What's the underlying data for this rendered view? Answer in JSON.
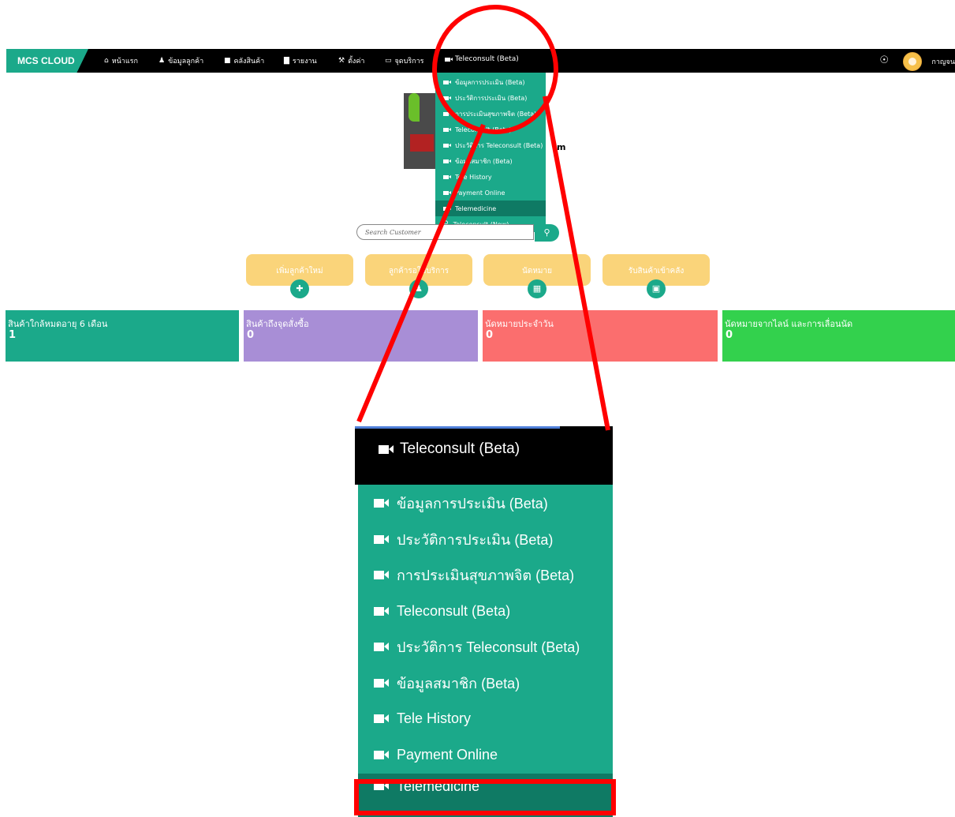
{
  "navbar": {
    "brand": "MCS CLOUD",
    "items": [
      {
        "icon": "home-icon",
        "glyph": "⌂",
        "label": "หน้าแรก"
      },
      {
        "icon": "users-icon",
        "glyph": "⚇",
        "label": "ข้อมูลลูกค้า"
      },
      {
        "icon": "warehouse-icon",
        "glyph": "■",
        "label": "คลังสินค้า"
      },
      {
        "icon": "chart-icon",
        "glyph": "▇",
        "label": "รายงาน"
      },
      {
        "icon": "wrench-icon",
        "glyph": "⚒",
        "label": "ตั้งค่า"
      },
      {
        "icon": "monitor-icon",
        "glyph": "▭",
        "label": "จุดบริการ"
      },
      {
        "icon": "video-icon",
        "glyph": "■",
        "label": "Teleconsult (Beta)"
      }
    ],
    "globe_icon": "globe-icon",
    "user_name": "กาญจน"
  },
  "dropdown": {
    "items": [
      {
        "label": "ข้อมูลการประเมิน (Beta)",
        "icon": "video-icon"
      },
      {
        "label": "ประวัติการประเมิน (Beta)",
        "icon": "video-icon"
      },
      {
        "label": "การประเมินสุขภาพจิต (Beta)",
        "icon": "video-icon"
      },
      {
        "label": "Teleconsult (Beta)",
        "icon": "video-icon"
      },
      {
        "label": "ประวัติการ Teleconsult (Beta)",
        "icon": "video-icon"
      },
      {
        "label": "ข้อมูลสมาชิก (Beta)",
        "icon": "video-icon"
      },
      {
        "label": "Tele History",
        "icon": "video-icon"
      },
      {
        "label": "Payment Online",
        "icon": "video-icon"
      },
      {
        "label": "Telemedicine",
        "icon": "video-icon",
        "active": true
      },
      {
        "label": "Teleconsult (New)",
        "icon": "link-icon"
      }
    ]
  },
  "search": {
    "placeholder": "Search Customer",
    "icon": "search-icon"
  },
  "quick_buttons": [
    {
      "label": "เพิ่มลูกค้าใหม่",
      "icon": "add-user-icon",
      "glyph": "✚"
    },
    {
      "label": "ลูกค้ารอใช้บริการ",
      "icon": "users-icon",
      "glyph": "⚇"
    },
    {
      "label": "นัดหมาย",
      "icon": "calendar-icon",
      "glyph": "▦"
    },
    {
      "label": "รับสินค้าเข้าคลัง",
      "icon": "archive-icon",
      "glyph": "▣"
    }
  ],
  "cards": [
    {
      "title": "สินค้าใกล้หมดอายุ 6 เดือน",
      "value": "1",
      "color": "#1ba98a"
    },
    {
      "title": "สินค้าถึงจุดสั่งซื้อ",
      "value": "0",
      "color": "#a88ed6"
    },
    {
      "title": "นัดหมายประจำวัน",
      "value": "0",
      "color": "#fb6e6e"
    },
    {
      "title": "นัดหมายจากไลน์ และการเลื่อนนัด",
      "value": "0",
      "color": "#33d14d"
    }
  ],
  "zoom": {
    "header": "Teleconsult (Beta)",
    "items": [
      "ข้อมูลการประเมิน (Beta)",
      "ประวัติการประเมิน (Beta)",
      "การประเมินสุขภาพจิต (Beta)",
      "Teleconsult (Beta)",
      "ประวัติการ Teleconsult (Beta)",
      "ข้อมูลสมาชิก (Beta)",
      "Tele History",
      "Payment Online",
      "Telemedicine"
    ]
  },
  "colors": {
    "brand_green": "#1ba98a",
    "active_green": "#0f7a64",
    "annotation_red": "#ff0000"
  }
}
